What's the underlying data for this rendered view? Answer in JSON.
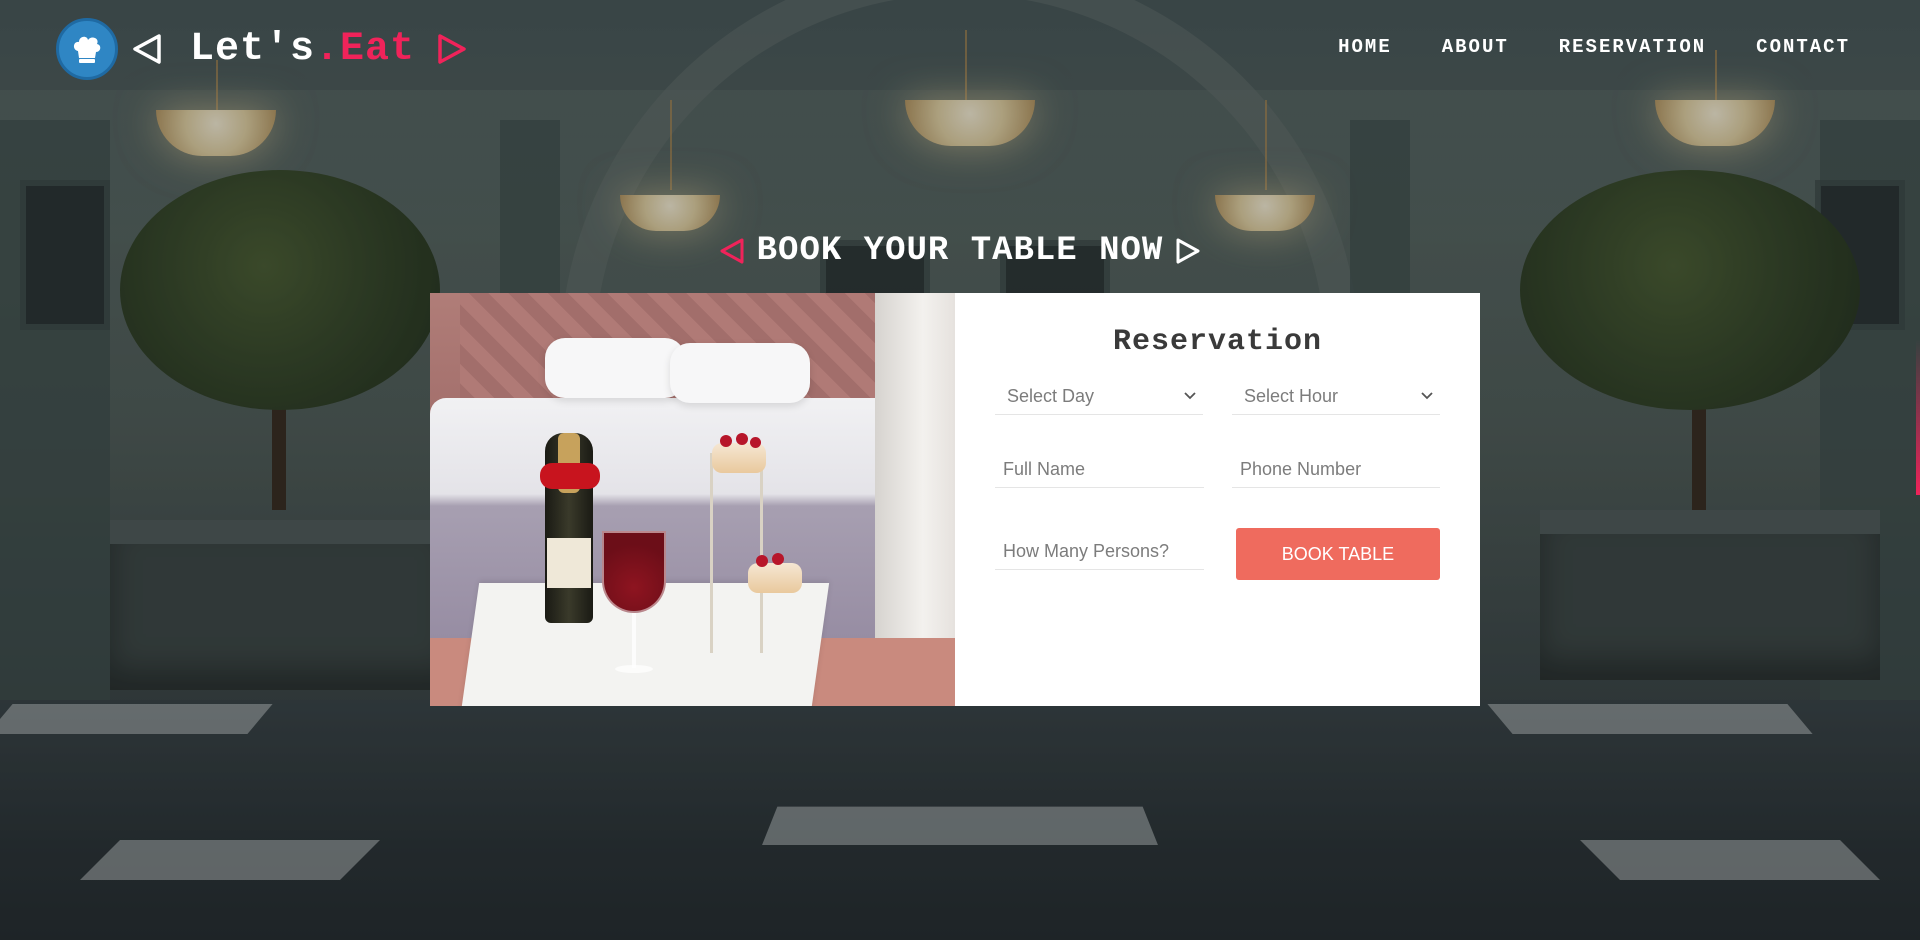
{
  "brand": {
    "prefix": "Let's",
    "accent": ".Eat",
    "badge_icon": "chef-hat-icon",
    "accent_color": "#f0235a"
  },
  "nav": {
    "items": [
      {
        "label": "HOME"
      },
      {
        "label": "ABOUT"
      },
      {
        "label": "RESERVATION"
      },
      {
        "label": "CONTACT"
      }
    ]
  },
  "section": {
    "heading": "BOOK YOUR TABLE NOW"
  },
  "reservation": {
    "title": "Reservation",
    "day_select": {
      "placeholder": "Select Day"
    },
    "hour_select": {
      "placeholder": "Select Hour"
    },
    "name_field": {
      "placeholder": "Full Name"
    },
    "phone_field": {
      "placeholder": "Phone Number"
    },
    "persons_field": {
      "placeholder": "How Many Persons?"
    },
    "submit_label": "BOOK TABLE",
    "button_color": "#ef6b5e"
  }
}
